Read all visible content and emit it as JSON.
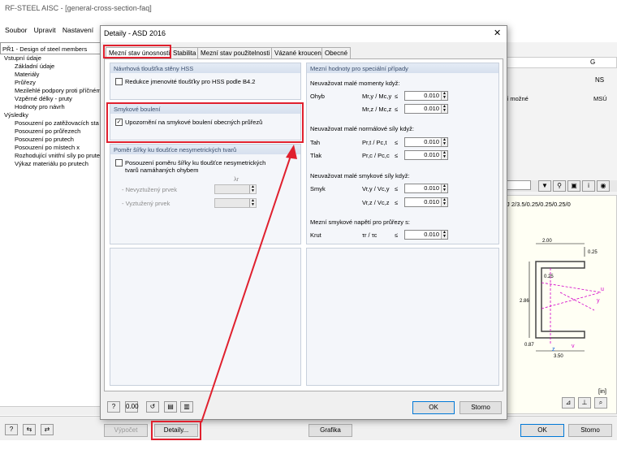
{
  "main": {
    "title": "RF-STEEL AISC - [general-cross-section-faq]",
    "menu": [
      "Soubor",
      "Upravit",
      "Nastavení"
    ],
    "case_combo": "PŘ1 - Design of steel members",
    "tree": [
      {
        "label": "Vstupní údaje",
        "level": 0
      },
      {
        "label": "Základní údaje",
        "level": 1
      },
      {
        "label": "Materiály",
        "level": 1
      },
      {
        "label": "Průřezy",
        "level": 1
      },
      {
        "label": "Mezilehlé podpory proti příčném",
        "level": 1
      },
      {
        "label": "Vzpěrné délky - pruty",
        "level": 1
      },
      {
        "label": "Hodnoty pro návrh",
        "level": 1
      },
      {
        "label": "Výsledky",
        "level": 0
      },
      {
        "label": "Posouzení po zatěžovacích sta",
        "level": 1
      },
      {
        "label": "Posouzení po průřezech",
        "level": 1
      },
      {
        "label": "Posouzení po prutech",
        "level": 1
      },
      {
        "label": "Posouzení po místech x",
        "level": 1
      },
      {
        "label": "Rozhodující vnitřní síly po prute",
        "level": 1
      },
      {
        "label": "Výkaz materiálu po prutech",
        "level": 1
      }
    ],
    "right": {
      "col_g": "G",
      "ns": "NS",
      "row_text": "ní možné",
      "row_msu": "MSÚ",
      "formula": "J 2/3.5/0.25/0.25/0.25/0",
      "dims": [
        "2.00",
        "0.25",
        "2.86",
        "0.25",
        "0.87",
        "3.50"
      ],
      "axes": [
        "u",
        "y",
        "z",
        "v"
      ],
      "unit": "[in]"
    },
    "bottom": {
      "calc_label": "Výpočet",
      "details_label": "Detaily...",
      "graphics_label": "Grafika",
      "ok_label": "OK",
      "cancel_label": "Storno"
    }
  },
  "dialog": {
    "title": "Detaily - ASD 2016",
    "close": "✕",
    "tabs": [
      "Mezní stav únosnosti",
      "Stabilita",
      "Mezní stav použitelnosti",
      "Vázané kroucení",
      "Obecné"
    ],
    "hss": {
      "title": "Návrhová tloušťka stěny HSS",
      "checkbox_label": "Redukce jmenovité tloušťky pro HSS podle B4.2",
      "checked": false
    },
    "shear_buckling": {
      "title": "Smykové boulení",
      "checkbox_label": "Upozornění na smykové boulení obecných průřezů",
      "checked": true
    },
    "width_thickness": {
      "title": "Poměr šířky ku tloušťce nesymetrických tvarů",
      "checkbox_line1": "Posouzení poměru šířky ku tloušťce nesymetrických",
      "checkbox_line2": "tvarů namáhaných ohybem",
      "checked": false,
      "lambda": "λr",
      "rows": [
        {
          "label": "- Nevyztužený prvek",
          "value": ""
        },
        {
          "label": "- Vyztužený prvek",
          "value": ""
        }
      ]
    },
    "limits": {
      "title": "Mezní hodnoty pro speciální případy",
      "moments_heading": "Neuvažovat malé momenty když:",
      "bending_label": "Ohyb",
      "my_formula": "Mr,y / Mc,y",
      "mz_formula": "Mr,z / Mc,z",
      "my_value": "0.010",
      "mz_value": "0.010",
      "normal_heading": "Neuvažovat malé normálové síly když:",
      "tension_label": "Tah",
      "compression_label": "Tlak",
      "pt_formula": "Pr,t / Pc,t",
      "pc_formula": "Pr,c / Pc,c",
      "pt_value": "0.010",
      "pc_value": "0.010",
      "shear_heading": "Neuvažovat malé smykové síly když:",
      "shear_label": "Smyk",
      "vy_formula": "Vr,y / Vc,y",
      "vz_formula": "Vr,z / Vc,z",
      "vy_value": "0.010",
      "vz_value": "0.010",
      "stress_heading": "Mezní smykové napětí pro průřezy s:",
      "torsion_label": "Krut",
      "tau_formula": "τr / τc",
      "tau_value": "0.010",
      "le": "≤"
    },
    "ok_label": "OK",
    "cancel_label": "Storno"
  },
  "colors": {
    "highlight": "#e0202e",
    "panel_title": "#3c4f6e",
    "accent": "#0078d7",
    "section": "#d400c8"
  }
}
